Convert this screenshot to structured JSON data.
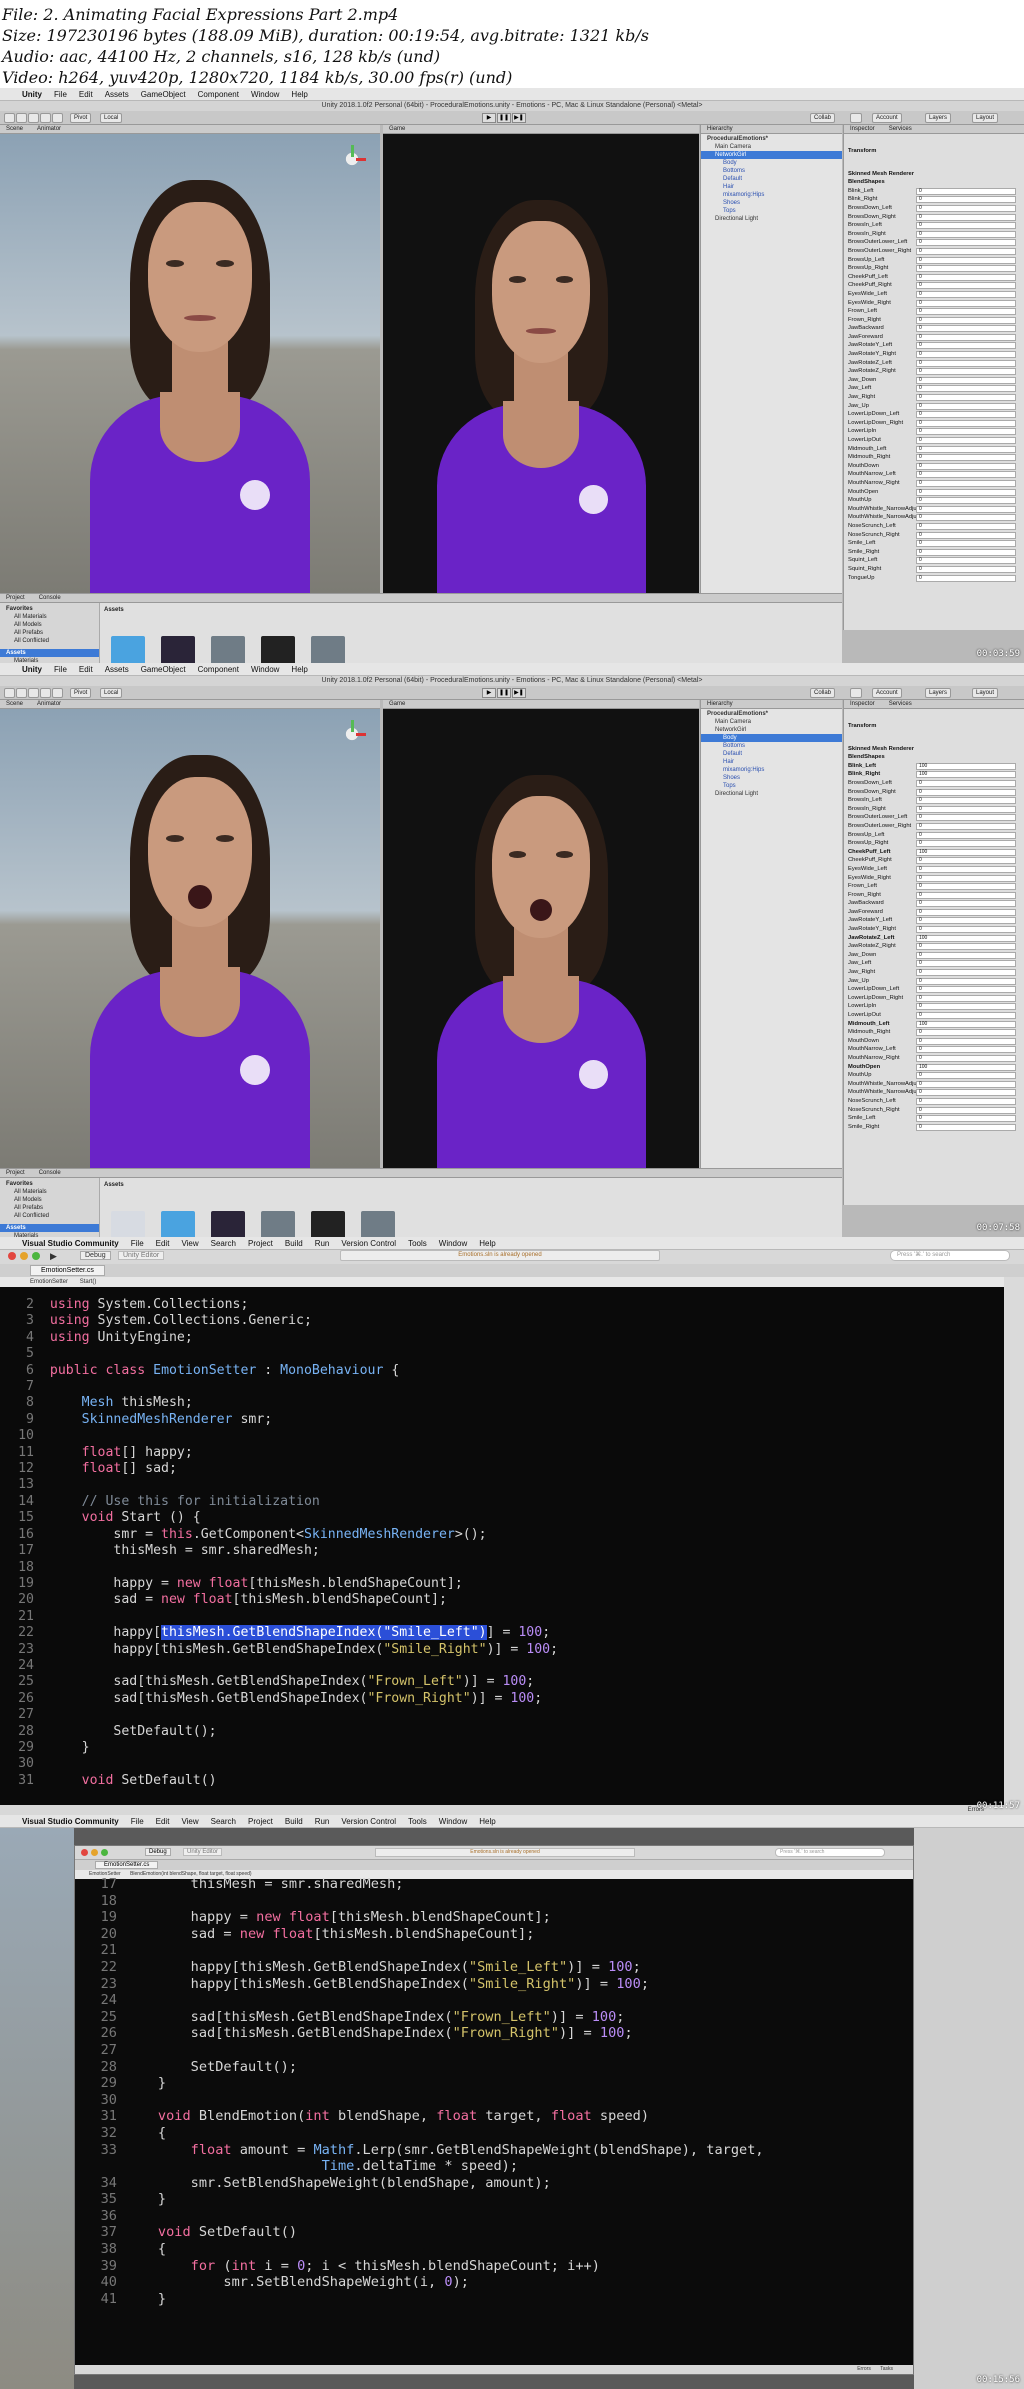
{
  "header": {
    "line1": "File: 2. Animating Facial Expressions Part 2.mp4",
    "line2": "Size: 197230196 bytes (188.09 MiB), duration: 00:19:54, avg.bitrate: 1321 kb/s",
    "line3": "Audio: aac, 44100 Hz, 2 channels, s16, 128 kb/s (und)",
    "line4": "Video: h264, yuv420p, 1280x720, 1184 kb/s, 30.00 fps(r) (und)"
  },
  "unity": {
    "menu": [
      "Unity",
      "File",
      "Edit",
      "Assets",
      "GameObject",
      "Component",
      "Window",
      "Help"
    ],
    "window_title": "Unity 2018.1.0f2 Personal (64bit) - ProceduralEmotions.unity - Emotions - PC, Mac & Linux Standalone (Personal) <Metal>",
    "pivot": "Pivot",
    "local": "Local",
    "collab": "Collab",
    "account": "Account",
    "layers": "Layers",
    "layout": "Layout",
    "scene_tab": "Scene",
    "animator_tab": "Animator",
    "game_tab": "Game",
    "hierarchy_tab": "Hierarchy",
    "inspector_tab": "Inspector",
    "services_tab": "Services",
    "project_tab": "Project",
    "console_tab": "Console",
    "create": "Create",
    "hierarchy_items": [
      "ProceduralEmotions*",
      "Main Camera",
      "NetworkGirl",
      "Body",
      "Bottoms",
      "Default",
      "Hair",
      "mixamorig:Hips",
      "Shoes",
      "Tops",
      "Directional Light"
    ],
    "favorites": [
      "Favorites",
      "All Materials",
      "All Models",
      "All Prefabs",
      "All Conflicted"
    ],
    "assets_tree": [
      "Assets",
      "Materials",
      "Textures"
    ],
    "assets_label": "Assets",
    "frame1_assets": [
      "NetworkGirl",
      "NetworkGirl",
      "Materials",
      "ProceduralEmoti...",
      "Textures"
    ],
    "frame2_assets": [
      "EmotionSetter",
      "NetworkGirl",
      "NetworkGirl",
      "Materials",
      "ProceduralEmoti...",
      "Textures"
    ],
    "inspector_transform": "Transform",
    "inspector_smr": "Skinned Mesh Renderer",
    "blendshapes_label": "BlendShapes",
    "frame1_blendshapes": [
      {
        "n": "Blink_Left",
        "v": "0"
      },
      {
        "n": "Blink_Right",
        "v": "0"
      },
      {
        "n": "BrowsDown_Left",
        "v": "0"
      },
      {
        "n": "BrowsDown_Right",
        "v": "0"
      },
      {
        "n": "BrowsIn_Left",
        "v": "0"
      },
      {
        "n": "BrowsIn_Right",
        "v": "0"
      },
      {
        "n": "BrowsOuterLower_Left",
        "v": "0"
      },
      {
        "n": "BrowsOuterLower_Right",
        "v": "0"
      },
      {
        "n": "BrowsUp_Left",
        "v": "0"
      },
      {
        "n": "BrowsUp_Right",
        "v": "0"
      },
      {
        "n": "CheekPuff_Left",
        "v": "0"
      },
      {
        "n": "CheekPuff_Right",
        "v": "0"
      },
      {
        "n": "EyesWide_Left",
        "v": "0"
      },
      {
        "n": "EyesWide_Right",
        "v": "0"
      },
      {
        "n": "Frown_Left",
        "v": "0"
      },
      {
        "n": "Frown_Right",
        "v": "0"
      },
      {
        "n": "JawBackward",
        "v": "0"
      },
      {
        "n": "JawForeward",
        "v": "0"
      },
      {
        "n": "JawRotateY_Left",
        "v": "0"
      },
      {
        "n": "JawRotateY_Right",
        "v": "0"
      },
      {
        "n": "JawRotateZ_Left",
        "v": "0"
      },
      {
        "n": "JawRotateZ_Right",
        "v": "0"
      },
      {
        "n": "Jaw_Down",
        "v": "0"
      },
      {
        "n": "Jaw_Left",
        "v": "0"
      },
      {
        "n": "Jaw_Right",
        "v": "0"
      },
      {
        "n": "Jaw_Up",
        "v": "0"
      },
      {
        "n": "LowerLipDown_Left",
        "v": "0"
      },
      {
        "n": "LowerLipDown_Right",
        "v": "0"
      },
      {
        "n": "LowerLipIn",
        "v": "0"
      },
      {
        "n": "LowerLipOut",
        "v": "0"
      },
      {
        "n": "Midmouth_Left",
        "v": "0"
      },
      {
        "n": "Midmouth_Right",
        "v": "0"
      },
      {
        "n": "MouthDown",
        "v": "0"
      },
      {
        "n": "MouthNarrow_Left",
        "v": "0"
      },
      {
        "n": "MouthNarrow_Right",
        "v": "0"
      },
      {
        "n": "MouthOpen",
        "v": "0"
      },
      {
        "n": "MouthUp",
        "v": "0"
      },
      {
        "n": "MouthWhistle_NarrowAdjust_Left",
        "v": "0"
      },
      {
        "n": "MouthWhistle_NarrowAdjust_Right",
        "v": "0"
      },
      {
        "n": "NoseScrunch_Left",
        "v": "0"
      },
      {
        "n": "NoseScrunch_Right",
        "v": "0"
      },
      {
        "n": "Smile_Left",
        "v": "0"
      },
      {
        "n": "Smile_Right",
        "v": "0"
      },
      {
        "n": "Squint_Left",
        "v": "0"
      },
      {
        "n": "Squint_Right",
        "v": "0"
      },
      {
        "n": "TongueUp",
        "v": "0"
      }
    ],
    "frame2_blendshapes": [
      {
        "n": "Blink_Left",
        "v": "100"
      },
      {
        "n": "Blink_Right",
        "v": "100"
      },
      {
        "n": "BrowsDown_Left",
        "v": "0"
      },
      {
        "n": "BrowsDown_Right",
        "v": "0"
      },
      {
        "n": "BrowsIn_Left",
        "v": "0"
      },
      {
        "n": "BrowsIn_Right",
        "v": "0"
      },
      {
        "n": "BrowsOuterLower_Left",
        "v": "0"
      },
      {
        "n": "BrowsOuterLower_Right",
        "v": "0"
      },
      {
        "n": "BrowsUp_Left",
        "v": "0"
      },
      {
        "n": "BrowsUp_Right",
        "v": "0"
      },
      {
        "n": "CheekPuff_Left",
        "v": "100"
      },
      {
        "n": "CheekPuff_Right",
        "v": "0"
      },
      {
        "n": "EyesWide_Left",
        "v": "0"
      },
      {
        "n": "EyesWide_Right",
        "v": "0"
      },
      {
        "n": "Frown_Left",
        "v": "0"
      },
      {
        "n": "Frown_Right",
        "v": "0"
      },
      {
        "n": "JawBackward",
        "v": "0"
      },
      {
        "n": "JawForeward",
        "v": "0"
      },
      {
        "n": "JawRotateY_Left",
        "v": "0"
      },
      {
        "n": "JawRotateY_Right",
        "v": "0"
      },
      {
        "n": "JawRotateZ_Left",
        "v": "100"
      },
      {
        "n": "JawRotateZ_Right",
        "v": "0"
      },
      {
        "n": "Jaw_Down",
        "v": "0"
      },
      {
        "n": "Jaw_Left",
        "v": "0"
      },
      {
        "n": "Jaw_Right",
        "v": "0"
      },
      {
        "n": "Jaw_Up",
        "v": "0"
      },
      {
        "n": "LowerLipDown_Left",
        "v": "0"
      },
      {
        "n": "LowerLipDown_Right",
        "v": "0"
      },
      {
        "n": "LowerLipIn",
        "v": "0"
      },
      {
        "n": "LowerLipOut",
        "v": "0"
      },
      {
        "n": "Midmouth_Left",
        "v": "100"
      },
      {
        "n": "Midmouth_Right",
        "v": "0"
      },
      {
        "n": "MouthDown",
        "v": "0"
      },
      {
        "n": "MouthNarrow_Left",
        "v": "0"
      },
      {
        "n": "MouthNarrow_Right",
        "v": "0"
      },
      {
        "n": "MouthOpen",
        "v": "100"
      },
      {
        "n": "MouthUp",
        "v": "0"
      },
      {
        "n": "MouthWhistle_NarrowAdjust_Left",
        "v": "0"
      },
      {
        "n": "MouthWhistle_NarrowAdjust_Right",
        "v": "0"
      },
      {
        "n": "NoseScrunch_Left",
        "v": "0"
      },
      {
        "n": "NoseScrunch_Right",
        "v": "0"
      },
      {
        "n": "Smile_Left",
        "v": "0"
      },
      {
        "n": "Smile_Right",
        "v": "0"
      }
    ],
    "frame1_ts": "00:03:59",
    "frame2_ts": "00:07:58"
  },
  "vs": {
    "menu": [
      "Visual Studio Community",
      "File",
      "Edit",
      "View",
      "Search",
      "Project",
      "Build",
      "Run",
      "Version Control",
      "Tools",
      "Window",
      "Help"
    ],
    "debug": "Debug",
    "unity_editor": "Unity Editor",
    "status": "Emotions.sln is already opened",
    "search_placeholder": "Press '⌘.' to search",
    "file_tab": "EmotionSetter.cs",
    "crumb1": "EmotionSetter",
    "crumb2": "Start()",
    "crumb3": "BlendEmotion(int blendShape, float target, float speed)",
    "errors": "Errors",
    "tasks": "Tasks",
    "frame3_ts": "00:11:57",
    "frame4_ts": "00:15:56"
  }
}
